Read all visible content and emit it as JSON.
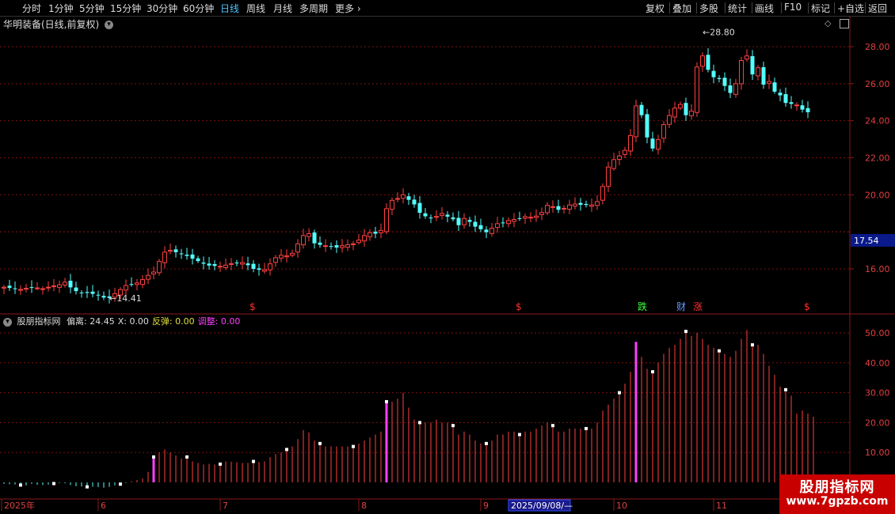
{
  "toolbar": {
    "left": [
      "分时",
      "1分钟",
      "5分钟",
      "15分钟",
      "30分钟",
      "60分钟",
      "日线",
      "周线",
      "月线",
      "多周期",
      "更多"
    ],
    "active": "日线",
    "right": [
      "复权",
      "叠加",
      "多股",
      "统计",
      "画线",
      "F10",
      "标记",
      "+自选",
      "返回"
    ]
  },
  "stock": {
    "title": "华明装备(日线,前复权)"
  },
  "price_axis": {
    "ticks": [
      "28.00",
      "26.00",
      "24.00",
      "22.00",
      "20.00",
      "16.00"
    ],
    "current": "17.54"
  },
  "annotations": {
    "high": "28.80",
    "low": "14.41"
  },
  "event_marks": [
    {
      "text": "$",
      "color": "#ff3030"
    },
    {
      "text": "$",
      "color": "#ff3030"
    },
    {
      "text": "跌",
      "color": "#40ff40"
    },
    {
      "text": "财",
      "color": "#6699ff"
    },
    {
      "text": "涨",
      "color": "#ff3030"
    },
    {
      "text": "$",
      "color": "#ff3030"
    }
  ],
  "indicator": {
    "name": "股朋指标网",
    "items": [
      {
        "label": "偏离: 24.45",
        "color": "#dddddd"
      },
      {
        "label": "X: 0.00",
        "color": "#dddddd"
      },
      {
        "label": "反弹: 0.00",
        "color": "#e0e040"
      },
      {
        "label": "调整: 0.00",
        "color": "#ff40ff"
      }
    ],
    "axis_ticks": [
      "50.00",
      "40.00",
      "30.00",
      "20.00",
      "10.00"
    ]
  },
  "date_axis": [
    "2025年",
    "6",
    "7",
    "8",
    "9",
    "2025/09/08/—",
    "10",
    "11"
  ],
  "watermark": {
    "title": "股朋指标网",
    "url": "www.7gpzb.com"
  },
  "colors": {
    "up": "#ff4040",
    "down": "#54ffff",
    "grid": "#7a1010",
    "special": "#ff40ff"
  },
  "chart_data": {
    "type": "candlestick",
    "price_ylim": [
      14,
      29
    ],
    "indicator_ylim": [
      -3,
      52
    ],
    "days": 146,
    "closes": [
      15.01,
      14.97,
      14.93,
      14.89,
      14.95,
      15.01,
      14.97,
      14.93,
      15.01,
      15.08,
      15.14,
      15.28,
      15.0,
      14.8,
      14.72,
      14.7,
      14.65,
      14.6,
      14.45,
      14.43,
      14.66,
      14.88,
      15.1,
      15.15,
      15.24,
      15.42,
      15.65,
      15.83,
      16.4,
      16.9,
      17.0,
      16.9,
      16.8,
      16.7,
      16.55,
      16.42,
      16.28,
      16.18,
      16.16,
      16.14,
      16.2,
      16.28,
      16.32,
      16.34,
      16.2,
      16.0,
      15.95,
      15.95,
      16.27,
      16.6,
      16.73,
      16.7,
      16.84,
      17.35,
      17.8,
      17.9,
      17.38,
      17.3,
      17.25,
      17.2,
      17.15,
      17.25,
      17.3,
      17.35,
      17.55,
      17.8,
      17.95,
      17.9,
      18.08,
      19.25,
      19.7,
      19.8,
      20.0,
      19.73,
      19.48,
      19.03,
      18.84,
      18.77,
      18.83,
      18.99,
      18.82,
      18.68,
      18.36,
      18.72,
      18.54,
      18.28,
      18.14,
      17.98,
      18.2,
      18.44,
      18.5,
      18.61,
      18.67,
      18.7,
      18.82,
      18.79,
      18.85,
      19.04,
      19.43,
      19.36,
      19.19,
      19.27,
      19.45,
      19.5,
      19.46,
      19.45,
      19.45,
      19.63,
      20.45,
      21.5,
      21.9,
      22.1,
      22.4,
      23.2,
      24.8,
      24.3,
      23.1,
      22.5,
      22.98,
      23.79,
      24.28,
      24.68,
      24.88,
      24.3,
      24.52,
      26.9,
      27.5,
      26.75,
      26.35,
      26.25,
      25.88,
      25.5,
      26.0,
      27.25,
      27.5,
      26.5,
      26.86,
      25.95,
      26.12,
      25.57,
      25.37,
      24.96,
      24.91,
      24.85,
      24.6,
      24.46
    ],
    "oscillator": [
      -0.5,
      -0.6,
      -0.7,
      -0.9,
      -1.0,
      -0.5,
      -0.8,
      -0.9,
      -0.7,
      -0.4,
      -0.2,
      -0.3,
      -0.9,
      -1.3,
      -1.4,
      -1.5,
      -1.5,
      -1.6,
      -1.8,
      -1.5,
      -1.0,
      -0.6,
      -0.2,
      0.4,
      0.8,
      1.3,
      3.5,
      8.5,
      10.0,
      11.0,
      10.0,
      9.0,
      8.0,
      8.5,
      7.0,
      6.5,
      6.0,
      6.2,
      6.0,
      6.1,
      7.0,
      6.9,
      6.7,
      6.5,
      6.5,
      7.0,
      6.8,
      7.0,
      8.5,
      9.5,
      10.0,
      11.0,
      12.0,
      14.5,
      17.5,
      16.7,
      14.0,
      13.0,
      12.0,
      12.0,
      12.0,
      12.0,
      12.0,
      12.0,
      13.0,
      14.0,
      15.0,
      16.0,
      17.0,
      27.0,
      27.0,
      28.0,
      30.0,
      25.0,
      21.0,
      20.0,
      20.0,
      20.0,
      21.0,
      20.0,
      20.0,
      19.0,
      16.0,
      17.0,
      16.0,
      14.0,
      13.0,
      13.0,
      14.0,
      16.0,
      16.0,
      17.0,
      17.0,
      16.0,
      17.0,
      17.0,
      18.0,
      19.0,
      20.0,
      19.0,
      17.0,
      17.0,
      18.0,
      18.0,
      18.0,
      18.0,
      18.0,
      20.0,
      24.0,
      26.0,
      28.0,
      30.0,
      33.0,
      37.0,
      47.0,
      42.0,
      38.0,
      37.0,
      40.0,
      43.0,
      45.0,
      46.0,
      48.0,
      50.5,
      49.0,
      50.0,
      48.0,
      46.0,
      45.0,
      44.0,
      43.0,
      42.0,
      44.0,
      48.0,
      51.0,
      46.0,
      46.0,
      43.0,
      39.0,
      36.0,
      32.0,
      31.0,
      29.0,
      23.0,
      24.0,
      23.0,
      22.0
    ]
  }
}
